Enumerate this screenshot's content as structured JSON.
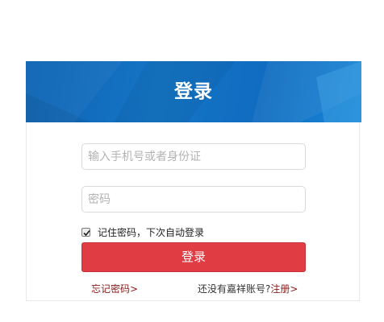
{
  "login": {
    "title": "登录",
    "phone_placeholder": "输入手机号或者身份证",
    "password_placeholder": "密码",
    "remember_label": "记住密码，下次自动登录",
    "remember_checked": true,
    "submit_label": "登录",
    "forgot_label": "忘记密码>",
    "register_prompt": "还没有嘉祥账号?",
    "register_label": "注册>"
  }
}
